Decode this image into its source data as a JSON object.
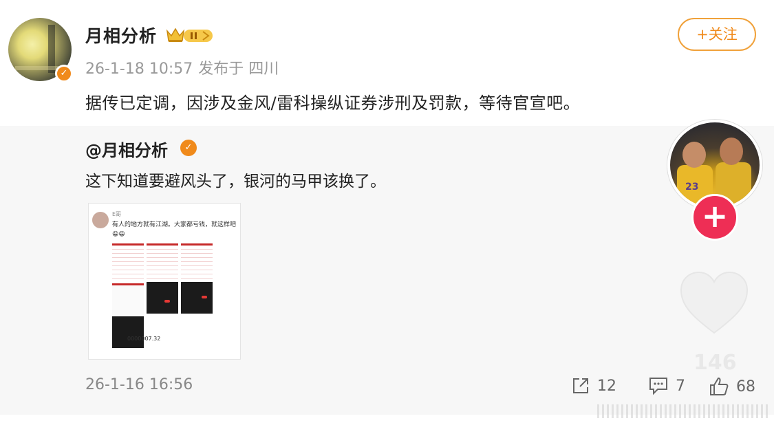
{
  "post": {
    "author": "月相分析",
    "time": "26-1-18 10:57",
    "source": "发布于 四川",
    "follow_label": "+关注",
    "text": "据传已定调，因涉及金风/雷科操纵证券涉刑及罚款，等待官宣吧。"
  },
  "repost": {
    "author": "@月相分析",
    "text": "这下知道要避风头了，银河的马甲该换了。",
    "time": "26-1-16 16:56",
    "image": {
      "name": "E哥",
      "text": "有人的地方就有江湖。大家都亏钱，就这样吧😀😀",
      "code": "0000007.32"
    },
    "actions": {
      "share_count": "12",
      "comment_count": "7",
      "like_count": "68"
    }
  },
  "overlay": {
    "jersey_number": "23",
    "plus_label": "+",
    "heart_count": "146"
  },
  "colors": {
    "accent": "#f08a1b",
    "plus": "#ee2e55"
  }
}
